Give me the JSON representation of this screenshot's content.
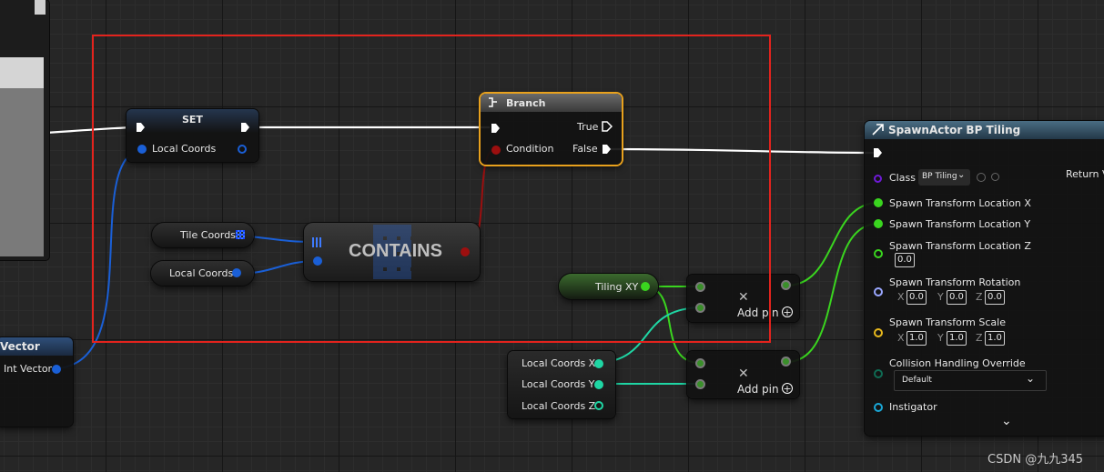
{
  "nodes": {
    "set": {
      "title": "SET",
      "pin_local_coords": "Local Coords"
    },
    "branch": {
      "title": "Branch",
      "true_label": "True",
      "condition_label": "Condition",
      "false_label": "False"
    },
    "tile_coords": {
      "label": "Tile Coords"
    },
    "local_coords": {
      "label": "Local Coords"
    },
    "contains": {
      "title": "CONTAINS"
    },
    "tiling_xy": {
      "label": "Tiling XY"
    },
    "break_vector": {
      "x_label": "Local Coords X",
      "y_label": "Local Coords Y",
      "z_label": "Local Coords Z"
    },
    "add_1": {
      "add_pin_label": "Add pin"
    },
    "add_2": {
      "add_pin_label": "Add pin"
    },
    "int_vector": {
      "title": "Vector",
      "pin_label": "Int Vector"
    },
    "spawn_actor": {
      "title": "SpawnActor BP Tiling",
      "class_label": "Class",
      "class_value": "BP Tiling",
      "return_value_label": "Return V",
      "location_x_label": "Spawn Transform Location X",
      "location_y_label": "Spawn Transform Location Y",
      "location_z_label": "Spawn Transform Location Z",
      "location_z_value": "0.0",
      "rotation_label": "Spawn Transform Rotation",
      "rotation_x": "0.0",
      "rotation_y": "0.0",
      "rotation_z": "0.0",
      "scale_label": "Spawn Transform Scale",
      "scale_x": "1.0",
      "scale_y": "1.0",
      "scale_z": "1.0",
      "axis_x": "X",
      "axis_y": "Y",
      "axis_z": "Z",
      "collision_label": "Collision Handling Override",
      "collision_value": "Default",
      "instigator_label": "Instigator"
    }
  },
  "watermark": "CSDN @九九345",
  "colors": {
    "selection_box": "#e3231d",
    "branch_highlight": "#e8a11d",
    "vector_pin": "#1a5fd6",
    "bool_pin": "#9c0f0f",
    "float_pin": "#3ad51f",
    "break_pin": "#1fd6a4",
    "exec_pin": "#ffffff",
    "class_pin": "#6e1ad6",
    "rotator_pin": "#9aa7ff",
    "scale_pin": "#e8b91d",
    "enum_pin": "#0f6b53",
    "object_pin": "#1aa7d6"
  },
  "icons": [
    "branch-icon",
    "spawn-actor-icon",
    "grid-icon",
    "chevron-down-icon",
    "add-pin-icon",
    "remove-icon",
    "reset-arrow-icon",
    "search-icon"
  ]
}
